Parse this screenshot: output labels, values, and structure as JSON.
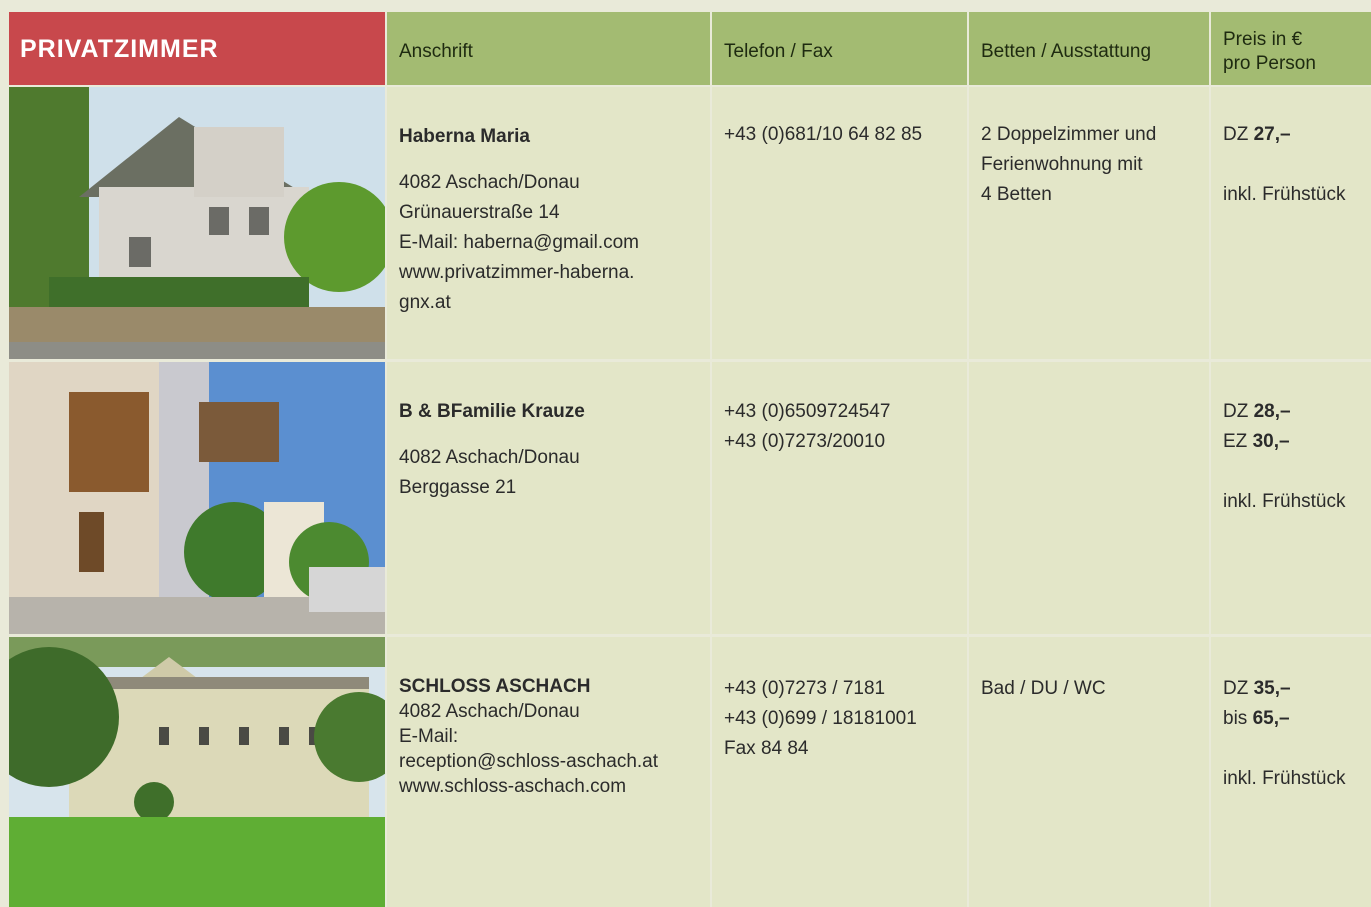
{
  "header": {
    "title": "PRIVATZIMMER",
    "col_anschrift": "Anschrift",
    "col_telefon": "Telefon / Fax",
    "col_betten": "Betten / Ausstattung",
    "col_preis_line1": "Preis in €",
    "col_preis_line2": "pro Person"
  },
  "rows": [
    {
      "photo_icon": "house-photo",
      "name": "Haberna Maria",
      "address": [
        "4082 Aschach/Donau",
        "Grünauerstraße 14",
        "E-Mail: haberna@gmail.com",
        "www.privatzimmer-haberna.",
        "gnx.at"
      ],
      "phones": [
        "+43 (0)681/10 64 82 85"
      ],
      "betten": [
        "2 Doppelzimmer und",
        "Ferienwohnung mit",
        "4 Betten"
      ],
      "prices": [
        {
          "label": "DZ",
          "value": "27,–"
        }
      ],
      "price_note": "inkl. Frühstück"
    },
    {
      "photo_icon": "street-photo",
      "name": "B & BFamilie Krauze",
      "address": [
        "4082 Aschach/Donau",
        "Berggasse 21"
      ],
      "phones": [
        "+43 (0)6509724547",
        "+43 (0)7273/20010"
      ],
      "betten": [],
      "prices": [
        {
          "label": "DZ",
          "value": "28,–"
        },
        {
          "label": "EZ",
          "value": "30,–"
        }
      ],
      "price_note": "inkl. Frühstück"
    },
    {
      "photo_icon": "castle-photo",
      "name": "SCHLOSS ASCHACH",
      "address": [
        "4082 Aschach/Donau",
        "E-Mail:",
        "reception@schloss-aschach.at",
        "www.schloss-aschach.com"
      ],
      "phones": [
        "+43 (0)7273 / 7181",
        "+43 (0)699 / 18181001",
        "Fax 84 84"
      ],
      "betten": [
        "Bad / DU / WC"
      ],
      "prices": [
        {
          "label": "DZ",
          "value": "35,–"
        },
        {
          "label": "bis",
          "value": "65,–"
        }
      ],
      "price_note": "inkl. Frühstück"
    }
  ]
}
